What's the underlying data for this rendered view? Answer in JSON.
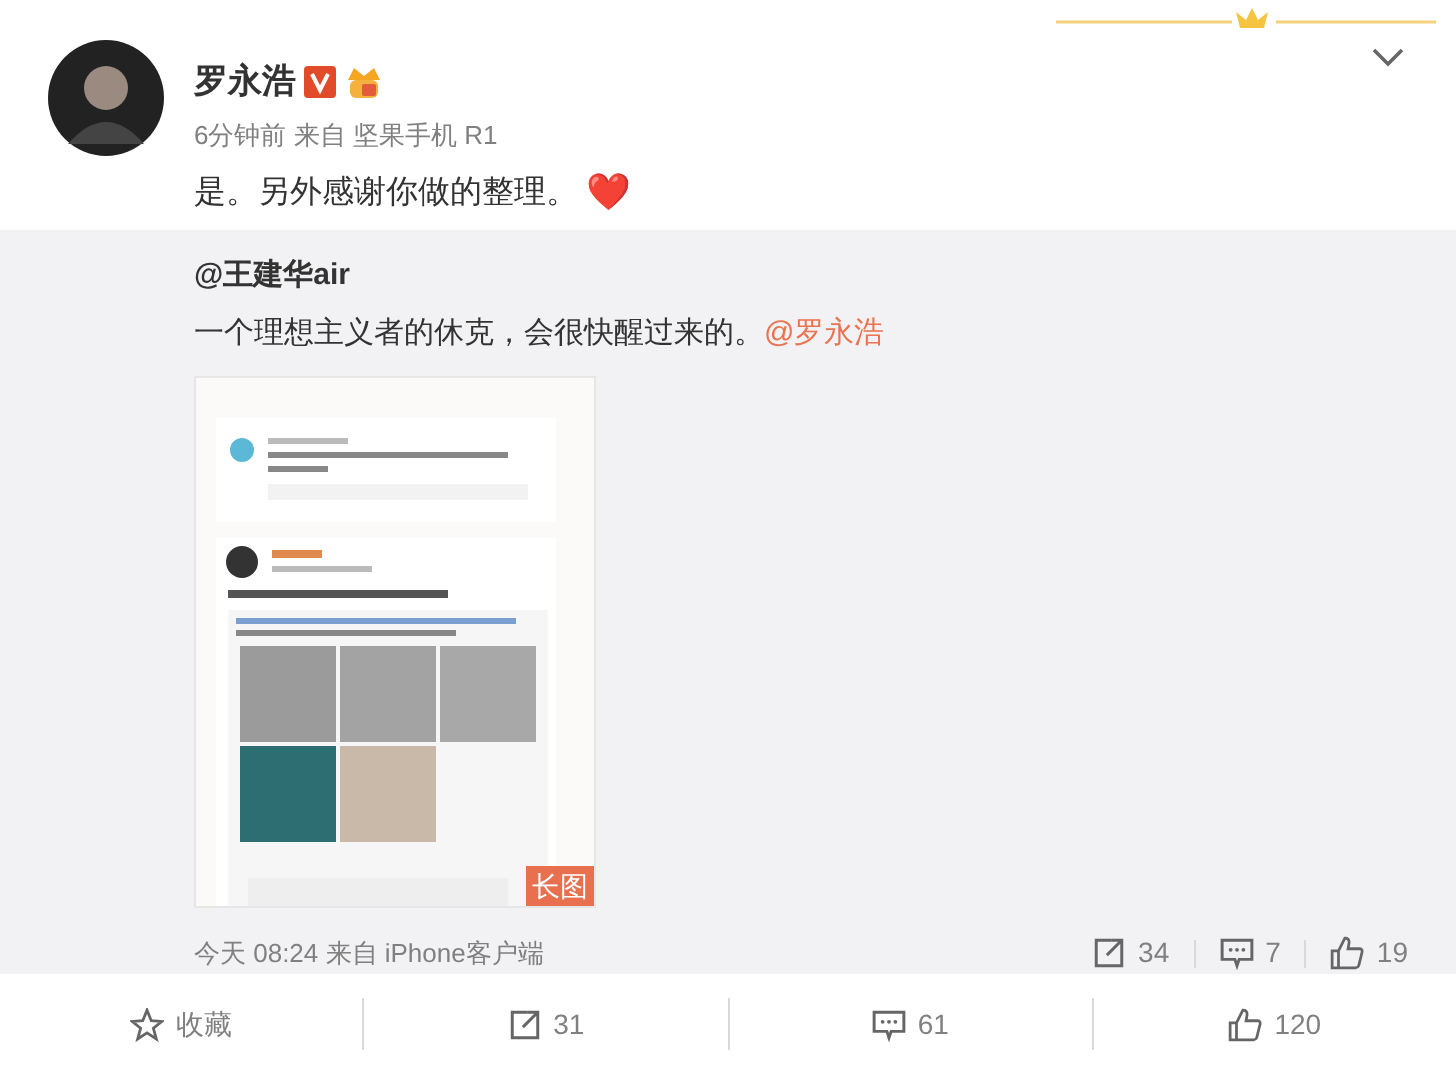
{
  "post": {
    "author": "罗永浩",
    "meta": "6分钟前 来自 坚果手机 R1",
    "text": "是。另外感谢你做的整理。",
    "emoji": "❤️"
  },
  "retweet": {
    "author": "@王建华air",
    "text": "一个理想主义者的休克，会很快醒过来的。",
    "mention": "@罗永浩",
    "image_badge": "长图",
    "time_source": "今天 08:24 来自 iPhone客户端",
    "stats": [
      {
        "kind": "repost",
        "count": "34"
      },
      {
        "kind": "comment",
        "count": "7"
      },
      {
        "kind": "like",
        "count": "19"
      }
    ]
  },
  "actions": [
    {
      "kind": "favorite",
      "label": "收藏"
    },
    {
      "kind": "repost",
      "label": "31"
    },
    {
      "kind": "comment",
      "label": "61"
    },
    {
      "kind": "like",
      "label": "120"
    }
  ]
}
